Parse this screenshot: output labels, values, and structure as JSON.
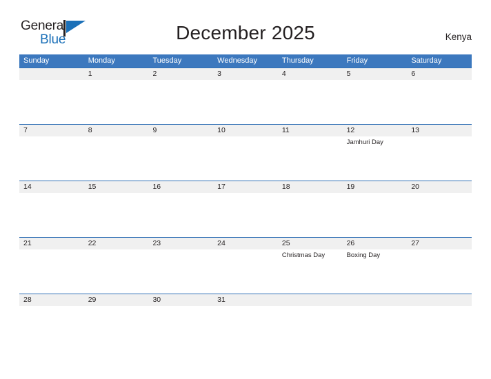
{
  "brand": {
    "name_part1": "General",
    "name_part2": "Blue",
    "flag_icon": "blue-flag-icon",
    "color_dark": "#231f20",
    "color_blue": "#1b70b8"
  },
  "header": {
    "title": "December 2025",
    "country": "Kenya"
  },
  "calendar": {
    "accent_color": "#3c78be",
    "row_band_color": "#f0f0f0",
    "weekdays": [
      "Sunday",
      "Monday",
      "Tuesday",
      "Wednesday",
      "Thursday",
      "Friday",
      "Saturday"
    ],
    "weeks": [
      {
        "days": [
          {
            "num": "",
            "event": ""
          },
          {
            "num": "1",
            "event": ""
          },
          {
            "num": "2",
            "event": ""
          },
          {
            "num": "3",
            "event": ""
          },
          {
            "num": "4",
            "event": ""
          },
          {
            "num": "5",
            "event": ""
          },
          {
            "num": "6",
            "event": ""
          }
        ]
      },
      {
        "days": [
          {
            "num": "7",
            "event": ""
          },
          {
            "num": "8",
            "event": ""
          },
          {
            "num": "9",
            "event": ""
          },
          {
            "num": "10",
            "event": ""
          },
          {
            "num": "11",
            "event": ""
          },
          {
            "num": "12",
            "event": "Jamhuri Day"
          },
          {
            "num": "13",
            "event": ""
          }
        ]
      },
      {
        "days": [
          {
            "num": "14",
            "event": ""
          },
          {
            "num": "15",
            "event": ""
          },
          {
            "num": "16",
            "event": ""
          },
          {
            "num": "17",
            "event": ""
          },
          {
            "num": "18",
            "event": ""
          },
          {
            "num": "19",
            "event": ""
          },
          {
            "num": "20",
            "event": ""
          }
        ]
      },
      {
        "days": [
          {
            "num": "21",
            "event": ""
          },
          {
            "num": "22",
            "event": ""
          },
          {
            "num": "23",
            "event": ""
          },
          {
            "num": "24",
            "event": ""
          },
          {
            "num": "25",
            "event": "Christmas Day"
          },
          {
            "num": "26",
            "event": "Boxing Day"
          },
          {
            "num": "27",
            "event": ""
          }
        ]
      },
      {
        "days": [
          {
            "num": "28",
            "event": ""
          },
          {
            "num": "29",
            "event": ""
          },
          {
            "num": "30",
            "event": ""
          },
          {
            "num": "31",
            "event": ""
          },
          {
            "num": "",
            "event": ""
          },
          {
            "num": "",
            "event": ""
          },
          {
            "num": "",
            "event": ""
          }
        ]
      }
    ]
  }
}
